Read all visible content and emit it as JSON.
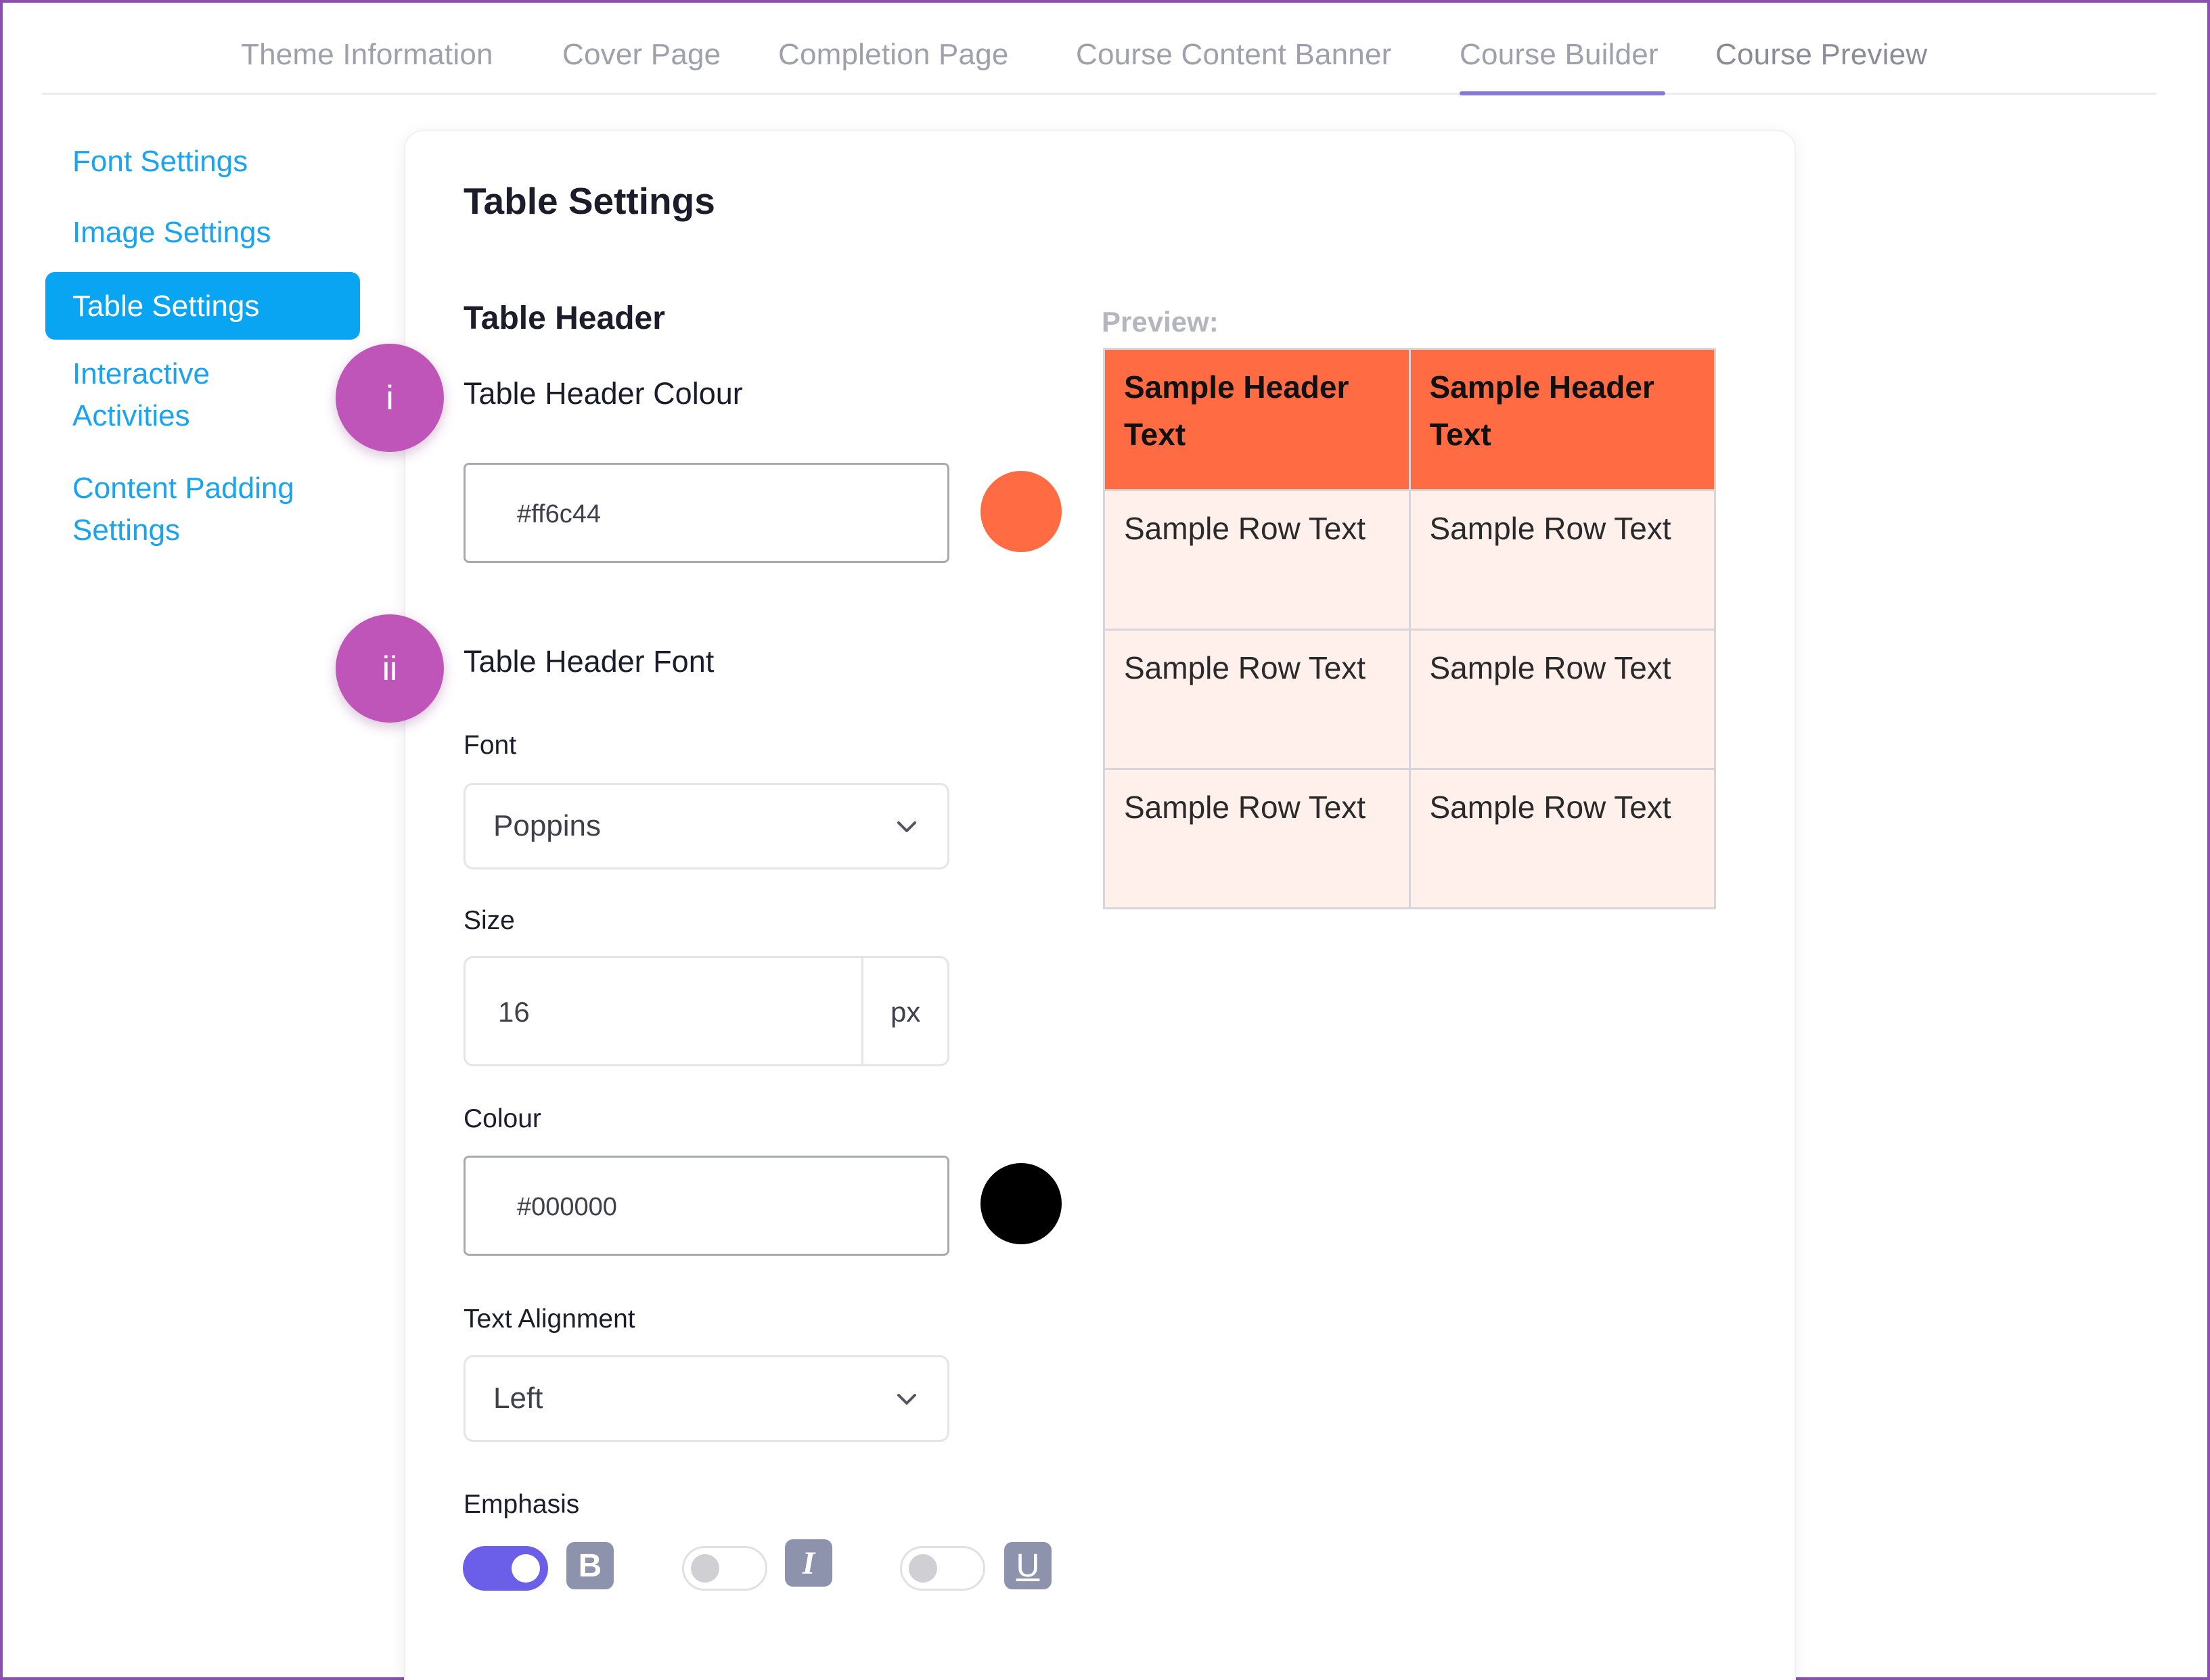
{
  "tabs": [
    {
      "label": "Theme Information"
    },
    {
      "label": "Cover Page"
    },
    {
      "label": "Completion Page"
    },
    {
      "label": "Course Content Banner"
    },
    {
      "label": "Course Builder"
    },
    {
      "label": "Course Preview"
    }
  ],
  "sidebar": {
    "items": [
      {
        "label": "Font Settings"
      },
      {
        "label": "Image Settings"
      },
      {
        "label": "Table Settings"
      },
      {
        "label_line1": "Interactive",
        "label_line2": "Activities"
      },
      {
        "label_line1": "Content Padding",
        "label_line2": "Settings"
      }
    ]
  },
  "card": {
    "title": "Table Settings",
    "section_title": "Table Header",
    "badges": [
      "i",
      "ii"
    ],
    "header_colour": {
      "label": "Table Header Colour",
      "value": "#ff6c44",
      "swatch": "#ff6c44"
    },
    "header_font": {
      "label": "Table Header Font",
      "font_label": "Font",
      "font_value": "Poppins",
      "size_label": "Size",
      "size_value": "16",
      "size_unit": "px",
      "colour_label": "Colour",
      "colour_value": "#000000",
      "colour_swatch": "#000000",
      "alignment_label": "Text Alignment",
      "alignment_value": "Left",
      "emphasis_label": "Emphasis",
      "emphasis": [
        {
          "icon": "B",
          "on": true
        },
        {
          "icon": "I",
          "on": false
        },
        {
          "icon": "U",
          "on": false
        }
      ]
    }
  },
  "preview": {
    "label": "Preview:",
    "headers": [
      "Sample Header Text",
      "Sample Header Text"
    ],
    "rows": [
      [
        "Sample Row Text",
        "Sample Row Text"
      ],
      [
        "Sample Row Text",
        "Sample Row Text"
      ],
      [
        "Sample Row Text",
        "Sample Row Text"
      ]
    ]
  },
  "colors": {
    "accent": "#0aa5f2",
    "badge": "#bf55b9",
    "toggle_on": "#6b5ee8",
    "header_bg": "#ff6c44",
    "row_bg": "#fff0eb"
  }
}
